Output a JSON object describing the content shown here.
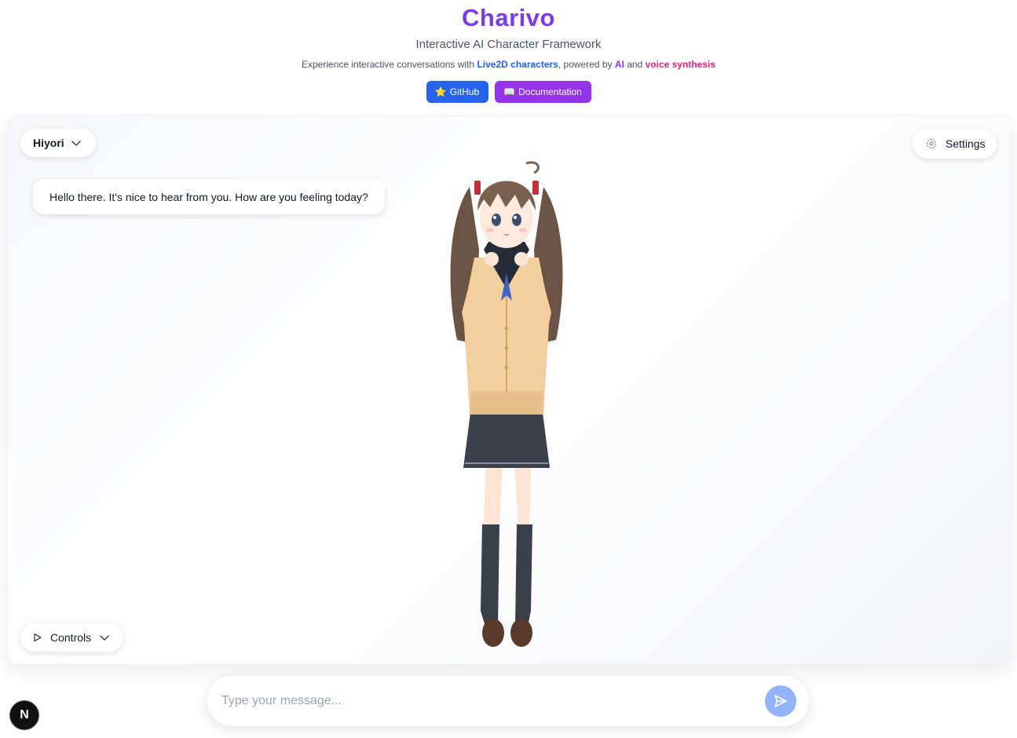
{
  "header": {
    "title": "Charivo",
    "subtitle": "Interactive AI Character Framework",
    "tagline": {
      "prefix": "Experience interactive conversations with ",
      "live2d": "Live2D characters",
      "middle": ", powered by ",
      "ai": "AI",
      "and": " and ",
      "voice": "voice synthesis"
    },
    "github": {
      "icon": "⭐",
      "label": "GitHub"
    },
    "docs": {
      "icon": "📖",
      "label": "Documentation"
    }
  },
  "stage": {
    "character_select": "Hiyori",
    "settings_label": "Settings",
    "controls_label": "Controls",
    "speech_bubble": "Hello there. It's nice to hear from you. How are you feeling today?"
  },
  "chat": {
    "placeholder": "Type your message..."
  },
  "badge": {
    "letter": "N"
  },
  "colors": {
    "brand": "#7c3aed",
    "github_button": "#2563eb",
    "docs_button": "#9333ea",
    "send_button": "#93b4fb"
  }
}
